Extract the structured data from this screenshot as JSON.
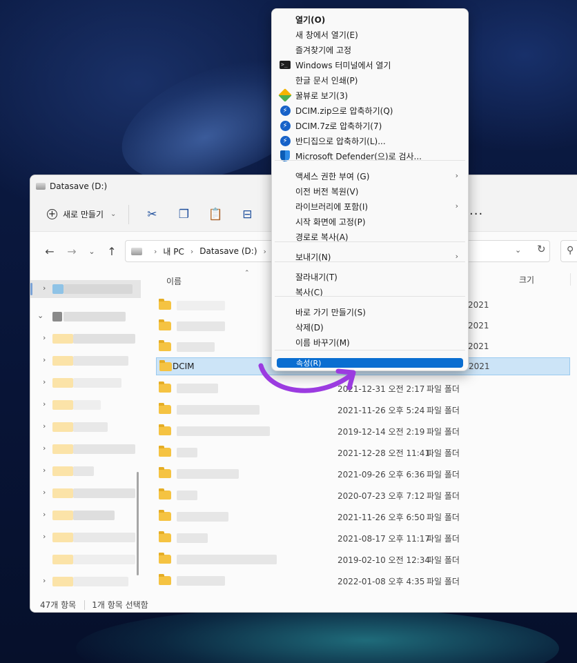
{
  "window": {
    "title": "Datasave (D:)",
    "toolbar": {
      "new_label": "새로 만들기"
    },
    "breadcrumb": [
      "내 PC",
      "Datasave (D:)"
    ],
    "columns": {
      "name": "이름",
      "size": "크기"
    },
    "selected_row": {
      "name": "DCIM"
    },
    "rows": [
      {
        "date": "2021-12-31 오전 2:17",
        "type": "파일 폴더"
      },
      {
        "date": "2021-11-26 오후 5:24",
        "type": "파일 폴더"
      },
      {
        "date": "2019-12-14 오전 2:19",
        "type": "파일 폴더"
      },
      {
        "date": "2021-12-28 오전 11:41",
        "type": "파일 폴더"
      },
      {
        "date": "2021-09-26 오후 6:36",
        "type": "파일 폴더"
      },
      {
        "date": "2020-07-23 오후 7:12",
        "type": "파일 폴더"
      },
      {
        "date": "2021-11-26 오후 6:50",
        "type": "파일 폴더"
      },
      {
        "date": "2021-08-17 오후 11:17",
        "type": "파일 폴더"
      },
      {
        "date": "2019-02-10 오전 12:34",
        "type": "파일 폴더"
      },
      {
        "date": "2022-01-08 오후 4:35",
        "type": "파일 폴더"
      }
    ],
    "partial_rows": [
      "2021",
      "2021",
      "2021",
      "2021"
    ],
    "status": {
      "count": "47개 항목",
      "selection": "1개 항목 선택함"
    }
  },
  "context_menu": {
    "items": [
      {
        "label": "열기(O)",
        "bold": true,
        "icon": ""
      },
      {
        "label": "새 창에서 열기(E)",
        "icon": ""
      },
      {
        "label": "즐겨찾기에 고정",
        "icon": ""
      },
      {
        "label": "Windows 터미널에서 열기",
        "icon": "terminal-icon"
      },
      {
        "label": "한글 문서 인쇄(P)",
        "icon": ""
      },
      {
        "label": "꿀뷰로 보기(3)",
        "icon": "honeyview-icon"
      },
      {
        "label": "DCIM.zip으로 압축하기(Q)",
        "icon": "bandizip-icon"
      },
      {
        "label": "DCIM.7z로 압축하기(7)",
        "icon": "bandizip-icon"
      },
      {
        "label": "반디집으로 압축하기(L)...",
        "icon": "bandizip-icon"
      },
      {
        "label": "Microsoft Defender(으)로 검사...",
        "icon": "defender-shield-icon"
      },
      {
        "label": "액세스 권한 부여 (G)",
        "submenu": true
      },
      {
        "label": "이전 버전 복원(V)"
      },
      {
        "label": "라이브러리에 포함(I)",
        "submenu": true
      },
      {
        "label": "시작 화면에 고정(P)"
      },
      {
        "label": "경로로 복사(A)"
      },
      {
        "label": "보내기(N)",
        "submenu": true
      },
      {
        "label": "잘라내기(T)"
      },
      {
        "label": "복사(C)"
      },
      {
        "label": "바로 가기 만들기(S)"
      },
      {
        "label": "삭제(D)"
      },
      {
        "label": "이름 바꾸기(M)"
      },
      {
        "label": "속성(R)",
        "highlighted": true
      }
    ]
  },
  "colors": {
    "highlight": "#0a6ed1",
    "selection": "#cce4f7",
    "annotation_arrow": "#9b3be0",
    "folder": "#f5c342"
  }
}
